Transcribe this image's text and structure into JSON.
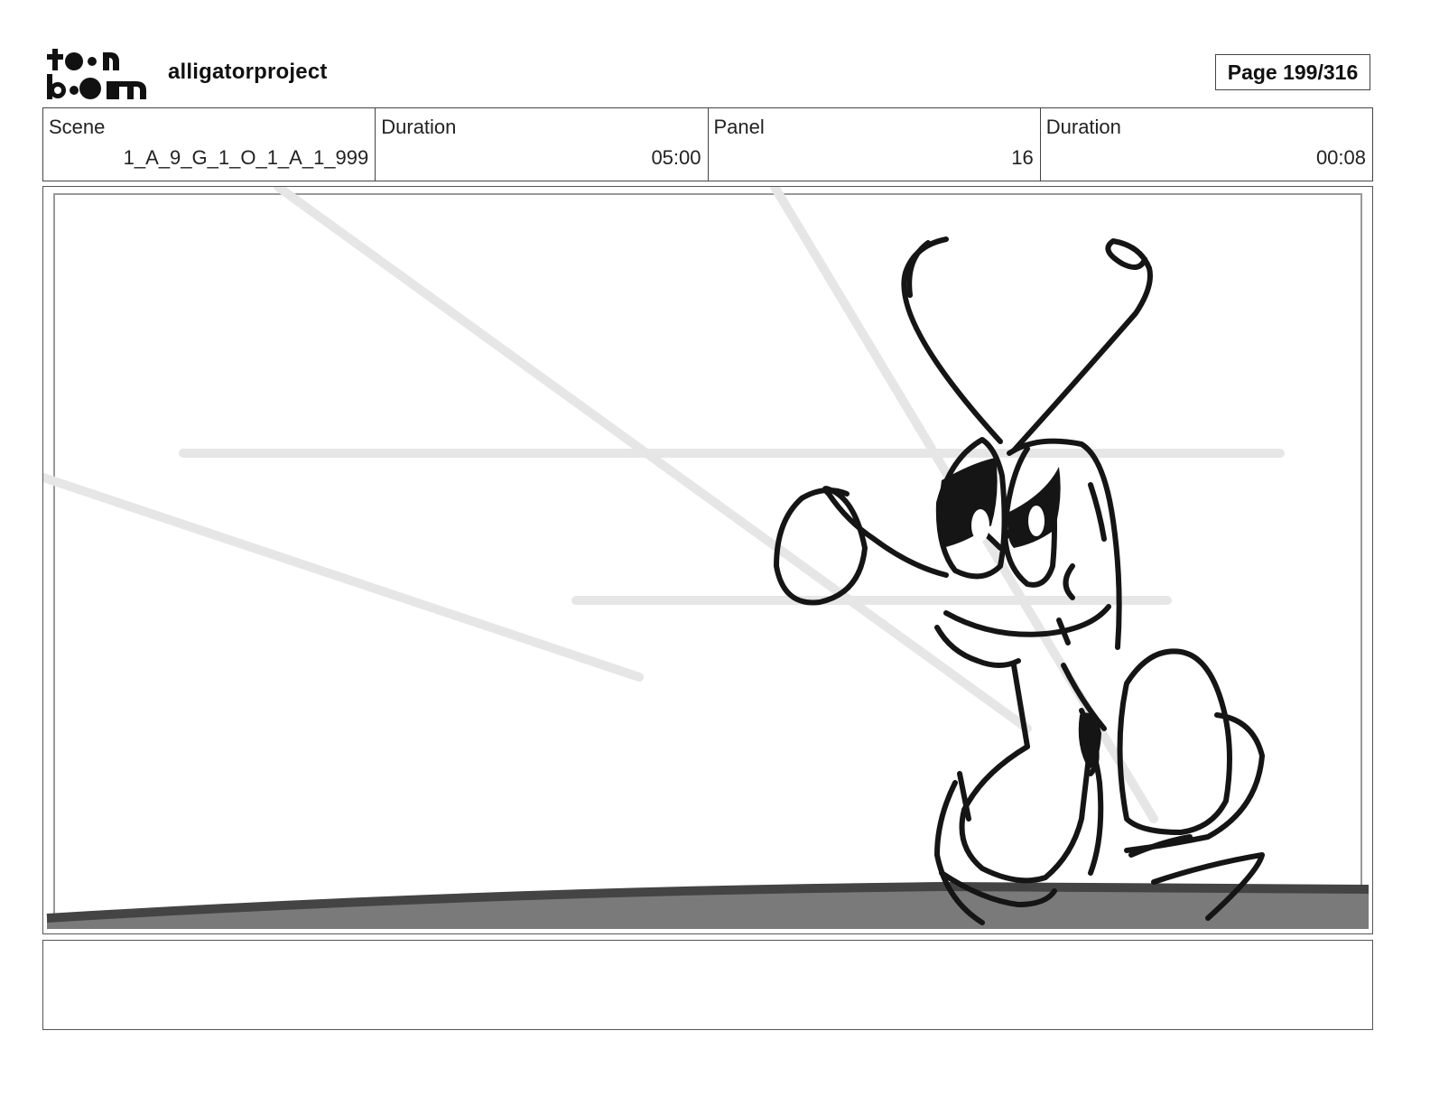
{
  "header": {
    "logo_text": "toon boom",
    "project_name": "alligatorproject",
    "page_label": "Page 199/316"
  },
  "info": {
    "scene_label": "Scene",
    "scene_value": "1_A_9_G_1_O_1_A_1_999",
    "scene_duration_label": "Duration",
    "scene_duration_value": "05:00",
    "panel_label": "Panel",
    "panel_value": "16",
    "panel_duration_label": "Duration",
    "panel_duration_value": "00:08"
  },
  "colors": {
    "ink": "#151515",
    "ground": "#7a7a7a",
    "ground_edge": "#444444",
    "guide_lines": "#e6e6e6"
  }
}
